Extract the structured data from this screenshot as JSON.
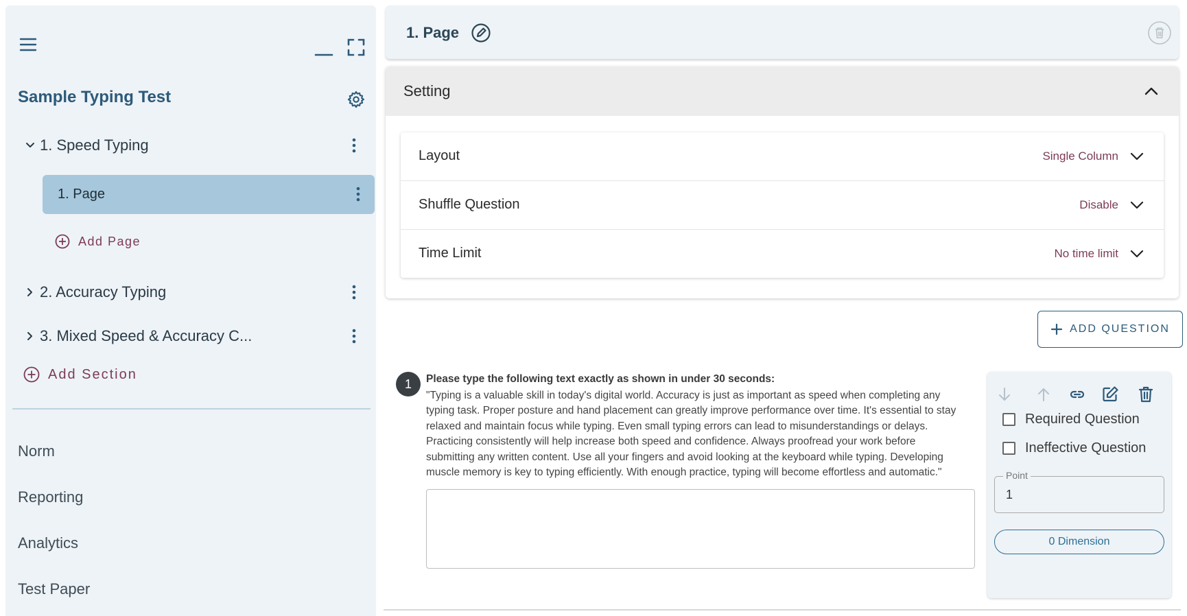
{
  "sidebar": {
    "title": "Sample Typing Test",
    "sections": [
      {
        "label": "1. Speed Typing",
        "expanded": true
      },
      {
        "label": "2. Accuracy Typing",
        "expanded": false
      },
      {
        "label": "3. Mixed Speed & Accuracy C...",
        "expanded": false
      }
    ],
    "pages": [
      {
        "label": "1.  Page",
        "selected": true
      }
    ],
    "add_page_label": "Add Page",
    "add_section_label": "Add Section",
    "nav": [
      "Norm",
      "Reporting",
      "Analytics",
      "Test Paper"
    ]
  },
  "page_header": {
    "title": "1. Page"
  },
  "setting": {
    "header_label": "Setting",
    "rows": [
      {
        "label": "Layout",
        "value": "Single Column"
      },
      {
        "label": "Shuffle Question",
        "value": "Disable"
      },
      {
        "label": "Time Limit",
        "value": "No time limit"
      }
    ]
  },
  "add_question_label": "ADD QUESTION",
  "question": {
    "number": "1",
    "title": "Please type the following text exactly as shown in under 30 seconds:",
    "lines": [
      "\"Typing is a valuable skill in today's digital world. Accuracy is just as important as speed when completing any",
      "typing task. Proper posture and hand placement can greatly improve performance over time. It's essential to stay",
      "relaxed and maintain focus while typing. Even small typing errors can lead to misunderstandings or delays.",
      "Practicing consistently will help increase both speed and confidence. Always proofread your work before",
      "submitting any written content. Use all your fingers and avoid looking at the keyboard while typing. Developing",
      "muscle memory is key to typing efficiently. With enough practice, typing will become effortless and automatic.\""
    ],
    "answer_value": "",
    "required_label": "Required Question",
    "ineffective_label": "Ineffective Question",
    "required_checked": false,
    "ineffective_checked": false,
    "point_label": "Point",
    "point_value": "1",
    "dimension_label": "0 Dimension"
  },
  "colors": {
    "brand": "#2c5a7a",
    "accent_text": "#7d3b56",
    "selected_bg": "#a6c7dc",
    "panel_bg": "#eef3f7"
  },
  "icons": {
    "menu": "hamburger-icon",
    "minimize": "minimize-icon",
    "fullscreen": "fullscreen-icon",
    "settings": "gear-icon",
    "edit": "edit-circle-icon",
    "delete": "trash-icon"
  }
}
